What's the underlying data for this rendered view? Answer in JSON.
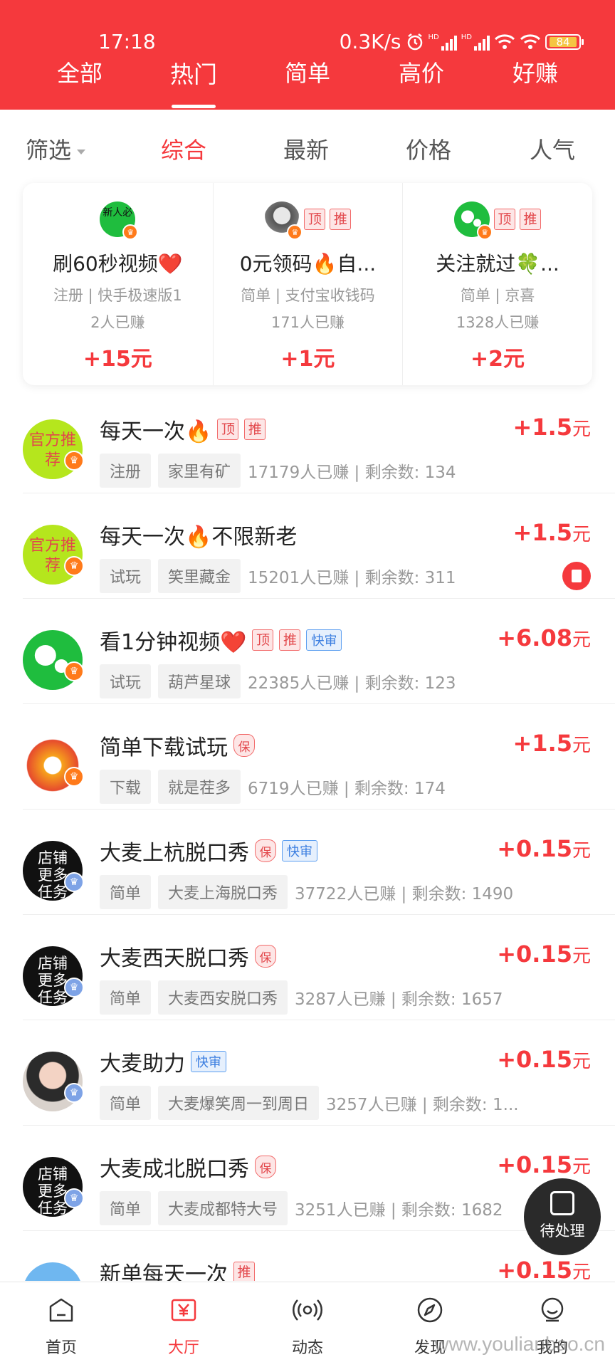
{
  "status_bar": {
    "time": "17:18",
    "net_speed": "0.3K/s",
    "signal1_label": "HD",
    "signal2_label": "HD",
    "battery": "84"
  },
  "top_tabs": [
    {
      "label": "全部",
      "active": false
    },
    {
      "label": "热门",
      "active": true
    },
    {
      "label": "简单",
      "active": false
    },
    {
      "label": "高价",
      "active": false
    },
    {
      "label": "好赚",
      "active": false
    }
  ],
  "filters": {
    "screen_label": "筛选",
    "items": [
      {
        "label": "综合",
        "active": true
      },
      {
        "label": "最新",
        "active": false
      },
      {
        "label": "价格",
        "active": false
      },
      {
        "label": "人气",
        "active": false
      }
    ]
  },
  "featured": [
    {
      "avatar_text": "新人必",
      "title": "刷60秒视频❤️",
      "sub": "注册 | 快手极速版1",
      "count": "2人已赚",
      "reward": "+15元",
      "badges": []
    },
    {
      "avatar_text": "",
      "title": "0元领码🔥自...",
      "sub": "简单 | 支付宝收钱码",
      "count": "171人已赚",
      "reward": "+1元",
      "badges": [
        "顶",
        "推"
      ]
    },
    {
      "avatar_text": "",
      "title": "关注就过🍀...",
      "sub": "简单 | 京喜",
      "count": "1328人已赚",
      "reward": "+2元",
      "badges": [
        "顶",
        "推"
      ]
    }
  ],
  "tasks": [
    {
      "avatar": "official",
      "avatar_text": "官方推荐",
      "title": "每天一次🔥",
      "badges": [
        "顶",
        "推"
      ],
      "fast": false,
      "bao": false,
      "chip1": "注册",
      "chip2": "家里有矿",
      "meta": "17179人已赚 | 剩余数: 134",
      "reward_num": "+1.5",
      "reward_unit": "元",
      "redpack": false
    },
    {
      "avatar": "official",
      "avatar_text": "官方推荐",
      "title": "每天一次🔥不限新老",
      "badges": [],
      "fast": false,
      "bao": false,
      "chip1": "试玩",
      "chip2": "笑里藏金",
      "meta": "15201人已赚 | 剩余数: 311",
      "reward_num": "+1.5",
      "reward_unit": "元",
      "redpack": true
    },
    {
      "avatar": "wechat",
      "avatar_text": "",
      "title": "看1分钟视频❤️",
      "badges": [
        "顶",
        "推"
      ],
      "fast": true,
      "bao": false,
      "chip1": "试玩",
      "chip2": "葫芦星球",
      "meta": "22385人已赚 | 剩余数: 123",
      "reward_num": "+6.08",
      "reward_unit": "元",
      "redpack": false
    },
    {
      "avatar": "game",
      "avatar_text": "",
      "title": "简单下载试玩",
      "badges": [],
      "fast": false,
      "bao": true,
      "chip1": "下载",
      "chip2": "就是茬多",
      "meta": "6719人已赚 | 剩余数: 174",
      "reward_num": "+1.5",
      "reward_unit": "元",
      "redpack": false
    },
    {
      "avatar": "shop",
      "avatar_text": "店铺更多任务",
      "title": "大麦上杭脱口秀",
      "badges": [],
      "fast": true,
      "bao": true,
      "chip1": "简单",
      "chip2": "大麦上海脱口秀",
      "meta": "37722人已赚 | 剩余数: 1490",
      "reward_num": "+0.15",
      "reward_unit": "元",
      "redpack": false
    },
    {
      "avatar": "shop",
      "avatar_text": "店铺更多任务",
      "title": "大麦西天脱口秀",
      "badges": [],
      "fast": false,
      "bao": true,
      "chip1": "简单",
      "chip2": "大麦西安脱口秀",
      "meta": "3287人已赚 | 剩余数: 1657",
      "reward_num": "+0.15",
      "reward_unit": "元",
      "redpack": false
    },
    {
      "avatar": "girl",
      "avatar_text": "",
      "title": "大麦助力",
      "badges": [],
      "fast": true,
      "bao": false,
      "chip1": "简单",
      "chip2": "大麦爆笑周一到周日",
      "meta": "3257人已赚 | 剩余数: 1...",
      "reward_num": "+0.15",
      "reward_unit": "元",
      "redpack": false
    },
    {
      "avatar": "shop",
      "avatar_text": "店铺更多任务",
      "title": "大麦成北脱口秀",
      "badges": [],
      "fast": false,
      "bao": true,
      "chip1": "简单",
      "chip2": "大麦成都特大号",
      "meta": "3251人已赚 | 剩余数: 1682",
      "reward_num": "+0.15",
      "reward_unit": "元",
      "redpack": false
    },
    {
      "avatar": "blue",
      "avatar_text": "",
      "title": "新单每天一次",
      "badges": [
        "推"
      ],
      "fast": false,
      "bao": false,
      "chip1": "",
      "chip2": "",
      "meta": "",
      "reward_num": "+0.15",
      "reward_unit": "元",
      "redpack": false
    }
  ],
  "badge_labels": {
    "fast": "快审",
    "bao": "保"
  },
  "float_button": {
    "label": "待处理"
  },
  "bottom_nav": [
    {
      "label": "首页",
      "icon": "home-icon",
      "active": false
    },
    {
      "label": "大厅",
      "icon": "hall-yuan-icon",
      "active": true
    },
    {
      "label": "动态",
      "icon": "broadcast-icon",
      "active": false
    },
    {
      "label": "发现",
      "icon": "compass-icon",
      "active": false
    },
    {
      "label": "我的",
      "icon": "profile-icon",
      "active": false
    }
  ],
  "watermark": "www.youlianbao.cn",
  "colors": {
    "brand_red": "#f5393d",
    "fast_blue": "#3b7ee0",
    "wechat_green": "#1fbd3e"
  }
}
